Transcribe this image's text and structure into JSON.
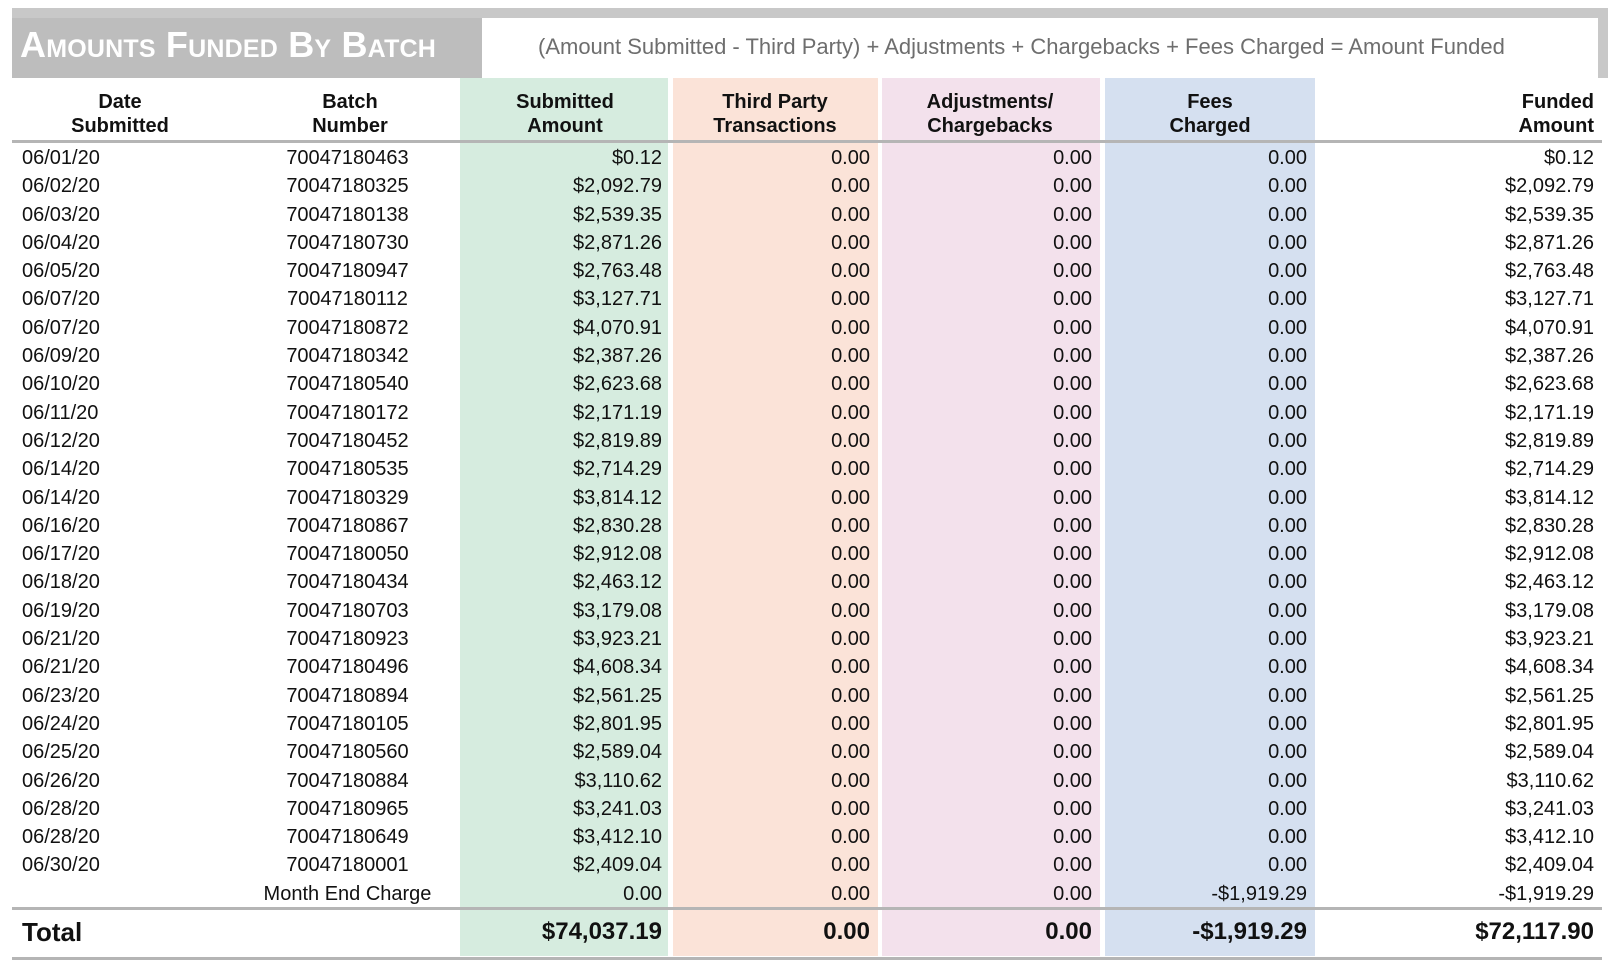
{
  "report": {
    "title": "Amounts Funded By Batch",
    "formula": "(Amount Submitted - Third Party) + Adjustments + Chargebacks + Fees Charged = Amount Funded"
  },
  "headers": {
    "date": "Date\nSubmitted",
    "batch": "Batch\nNumber",
    "submitted": "Submitted\nAmount",
    "third_party": "Third Party\nTransactions",
    "adjustments": "Adjustments/\nChargebacks",
    "fees": "Fees\nCharged",
    "funded": "Funded\nAmount"
  },
  "rows": [
    {
      "date": "06/01/20",
      "batch": "70047180463",
      "submitted": "$0.12",
      "third": "0.00",
      "adj": "0.00",
      "fees": "0.00",
      "funded": "$0.12"
    },
    {
      "date": "06/02/20",
      "batch": "70047180325",
      "submitted": "$2,092.79",
      "third": "0.00",
      "adj": "0.00",
      "fees": "0.00",
      "funded": "$2,092.79"
    },
    {
      "date": "06/03/20",
      "batch": "70047180138",
      "submitted": "$2,539.35",
      "third": "0.00",
      "adj": "0.00",
      "fees": "0.00",
      "funded": "$2,539.35"
    },
    {
      "date": "06/04/20",
      "batch": "70047180730",
      "submitted": "$2,871.26",
      "third": "0.00",
      "adj": "0.00",
      "fees": "0.00",
      "funded": "$2,871.26"
    },
    {
      "date": "06/05/20",
      "batch": "70047180947",
      "submitted": "$2,763.48",
      "third": "0.00",
      "adj": "0.00",
      "fees": "0.00",
      "funded": "$2,763.48"
    },
    {
      "date": "06/07/20",
      "batch": "70047180112",
      "submitted": "$3,127.71",
      "third": "0.00",
      "adj": "0.00",
      "fees": "0.00",
      "funded": "$3,127.71"
    },
    {
      "date": "06/07/20",
      "batch": "70047180872",
      "submitted": "$4,070.91",
      "third": "0.00",
      "adj": "0.00",
      "fees": "0.00",
      "funded": "$4,070.91"
    },
    {
      "date": "06/09/20",
      "batch": "70047180342",
      "submitted": "$2,387.26",
      "third": "0.00",
      "adj": "0.00",
      "fees": "0.00",
      "funded": "$2,387.26"
    },
    {
      "date": "06/10/20",
      "batch": "70047180540",
      "submitted": "$2,623.68",
      "third": "0.00",
      "adj": "0.00",
      "fees": "0.00",
      "funded": "$2,623.68"
    },
    {
      "date": "06/11/20",
      "batch": "70047180172",
      "submitted": "$2,171.19",
      "third": "0.00",
      "adj": "0.00",
      "fees": "0.00",
      "funded": "$2,171.19"
    },
    {
      "date": "06/12/20",
      "batch": "70047180452",
      "submitted": "$2,819.89",
      "third": "0.00",
      "adj": "0.00",
      "fees": "0.00",
      "funded": "$2,819.89"
    },
    {
      "date": "06/14/20",
      "batch": "70047180535",
      "submitted": "$2,714.29",
      "third": "0.00",
      "adj": "0.00",
      "fees": "0.00",
      "funded": "$2,714.29"
    },
    {
      "date": "06/14/20",
      "batch": "70047180329",
      "submitted": "$3,814.12",
      "third": "0.00",
      "adj": "0.00",
      "fees": "0.00",
      "funded": "$3,814.12"
    },
    {
      "date": "06/16/20",
      "batch": "70047180867",
      "submitted": "$2,830.28",
      "third": "0.00",
      "adj": "0.00",
      "fees": "0.00",
      "funded": "$2,830.28"
    },
    {
      "date": "06/17/20",
      "batch": "70047180050",
      "submitted": "$2,912.08",
      "third": "0.00",
      "adj": "0.00",
      "fees": "0.00",
      "funded": "$2,912.08"
    },
    {
      "date": "06/18/20",
      "batch": "70047180434",
      "submitted": "$2,463.12",
      "third": "0.00",
      "adj": "0.00",
      "fees": "0.00",
      "funded": "$2,463.12"
    },
    {
      "date": "06/19/20",
      "batch": "70047180703",
      "submitted": "$3,179.08",
      "third": "0.00",
      "adj": "0.00",
      "fees": "0.00",
      "funded": "$3,179.08"
    },
    {
      "date": "06/21/20",
      "batch": "70047180923",
      "submitted": "$3,923.21",
      "third": "0.00",
      "adj": "0.00",
      "fees": "0.00",
      "funded": "$3,923.21"
    },
    {
      "date": "06/21/20",
      "batch": "70047180496",
      "submitted": "$4,608.34",
      "third": "0.00",
      "adj": "0.00",
      "fees": "0.00",
      "funded": "$4,608.34"
    },
    {
      "date": "06/23/20",
      "batch": "70047180894",
      "submitted": "$2,561.25",
      "third": "0.00",
      "adj": "0.00",
      "fees": "0.00",
      "funded": "$2,561.25"
    },
    {
      "date": "06/24/20",
      "batch": "70047180105",
      "submitted": "$2,801.95",
      "third": "0.00",
      "adj": "0.00",
      "fees": "0.00",
      "funded": "$2,801.95"
    },
    {
      "date": "06/25/20",
      "batch": "70047180560",
      "submitted": "$2,589.04",
      "third": "0.00",
      "adj": "0.00",
      "fees": "0.00",
      "funded": "$2,589.04"
    },
    {
      "date": "06/26/20",
      "batch": "70047180884",
      "submitted": "$3,110.62",
      "third": "0.00",
      "adj": "0.00",
      "fees": "0.00",
      "funded": "$3,110.62"
    },
    {
      "date": "06/28/20",
      "batch": "70047180965",
      "submitted": "$3,241.03",
      "third": "0.00",
      "adj": "0.00",
      "fees": "0.00",
      "funded": "$3,241.03"
    },
    {
      "date": "06/28/20",
      "batch": "70047180649",
      "submitted": "$3,412.10",
      "third": "0.00",
      "adj": "0.00",
      "fees": "0.00",
      "funded": "$3,412.10"
    },
    {
      "date": "06/30/20",
      "batch": "70047180001",
      "submitted": "$2,409.04",
      "third": "0.00",
      "adj": "0.00",
      "fees": "0.00",
      "funded": "$2,409.04"
    },
    {
      "date": "",
      "batch": "Month End Charge",
      "submitted": "0.00",
      "third": "0.00",
      "adj": "0.00",
      "fees": "-$1,919.29",
      "funded": "-$1,919.29"
    }
  ],
  "total": {
    "label": "Total",
    "submitted": "$74,037.19",
    "third": "0.00",
    "adj": "0.00",
    "fees": "-$1,919.29",
    "funded": "$72,117.90"
  }
}
